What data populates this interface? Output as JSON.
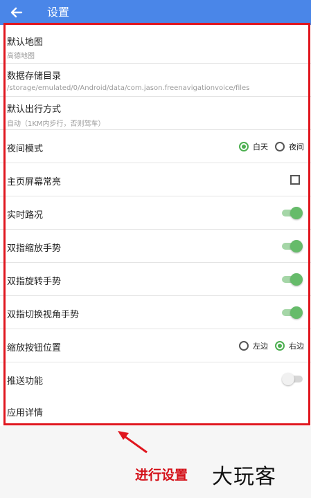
{
  "appbar": {
    "title": "设置",
    "back_icon": "arrow-left-icon"
  },
  "settings": {
    "default_map": {
      "label": "默认地图",
      "value": "高德地图"
    },
    "storage_dir": {
      "label": "数据存储目录",
      "value": "/storage/emulated/0/Android/data/com.jason.freenavigationvoice/files"
    },
    "travel_mode": {
      "label": "默认出行方式",
      "value": "自动（1KM内步行，否则驾车）"
    },
    "night_mode": {
      "label": "夜间模式",
      "options": [
        "白天",
        "夜间"
      ],
      "selected": "白天"
    },
    "screen_on": {
      "label": "主页屏幕常亮",
      "checked": false
    },
    "traffic": {
      "label": "实时路况",
      "on": true
    },
    "pinch_zoom": {
      "label": "双指缩放手势",
      "on": true
    },
    "rotate": {
      "label": "双指旋转手势",
      "on": true
    },
    "tilt": {
      "label": "双指切换视角手势",
      "on": true
    },
    "zoom_button": {
      "label": "缩放按钮位置",
      "options": [
        "左边",
        "右边"
      ],
      "selected": "右边"
    },
    "push": {
      "label": "推送功能",
      "on": false
    },
    "app_details": {
      "label": "应用详情"
    }
  },
  "annotation": {
    "caption": "进行设置",
    "watermark": "大玩客",
    "accent": "#e0161e"
  },
  "colors": {
    "appbar": "#4a86e8",
    "toggle_on": "#66bb6a"
  }
}
